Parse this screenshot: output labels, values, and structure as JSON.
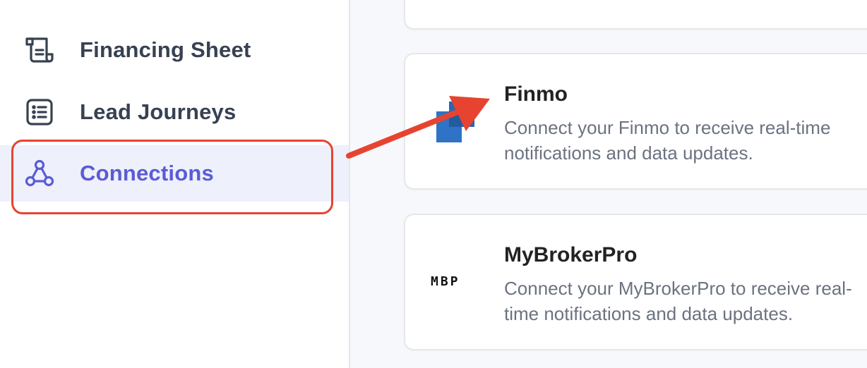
{
  "sidebar": {
    "items": [
      {
        "label": "Financing Sheet",
        "icon": "scroll-icon"
      },
      {
        "label": "Lead Journeys",
        "icon": "list-icon"
      },
      {
        "label": "Connections",
        "icon": "connections-icon",
        "active": true
      }
    ]
  },
  "integrations": [
    {
      "name": "Finmo",
      "description": "Connect your Finmo to receive real-time notifications and data updates.",
      "logo": "finmo-logo"
    },
    {
      "name": "MyBrokerPro",
      "description": "Connect your MyBrokerPro to receive real-time notifications and data updates.",
      "logo_text": "MBP",
      "logo": "mybrokerpro-logo"
    }
  ],
  "colors": {
    "accent": "#5b5bd6",
    "annotation": "#e64430",
    "finmo_blue": "#2f73c6"
  }
}
